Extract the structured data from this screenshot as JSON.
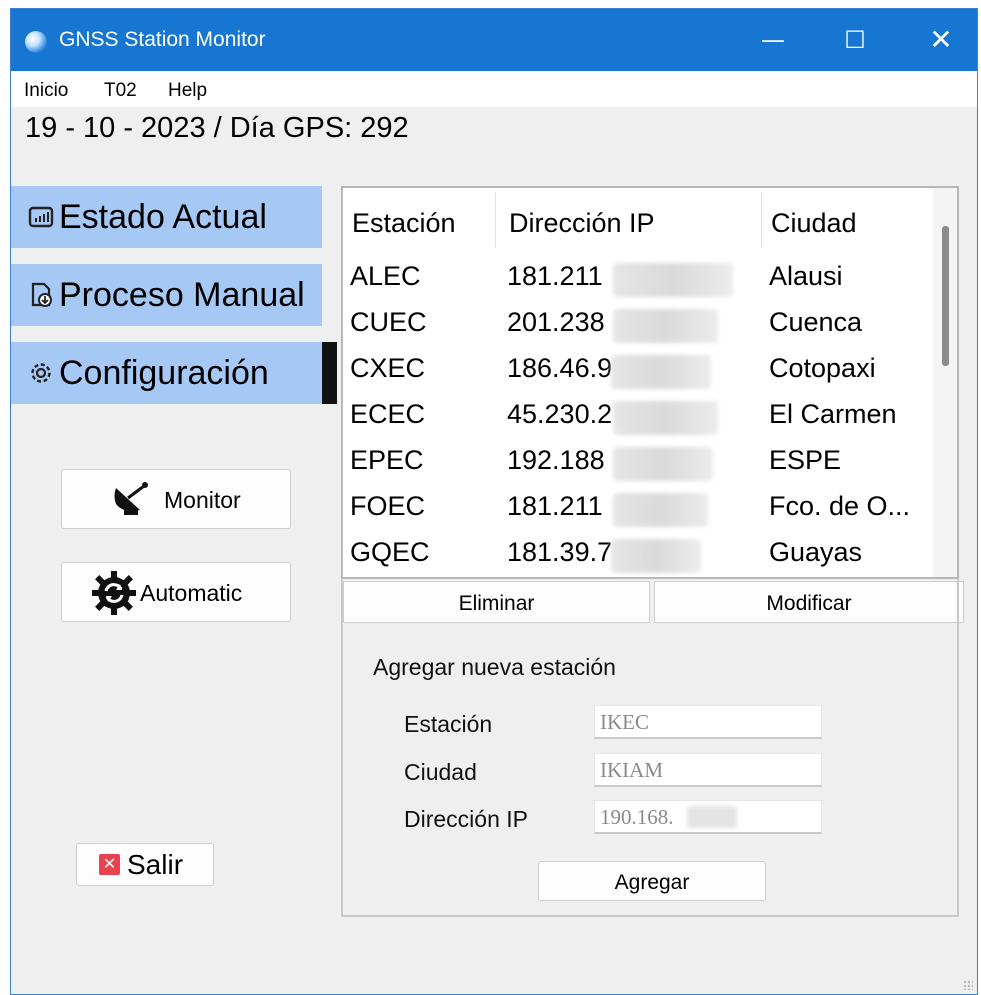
{
  "window": {
    "title": "GNSS Station Monitor",
    "controls": {
      "minimize": "—",
      "maximize": "☐",
      "close": "✕"
    }
  },
  "menu": [
    "Inicio",
    "T02",
    "Help"
  ],
  "date_line": "19 - 10 - 2023 / Día GPS: 292",
  "nav": [
    {
      "label": "Estado Actual",
      "icon": "monitor-icon"
    },
    {
      "label": "Proceso Manual",
      "icon": "document-download-icon"
    },
    {
      "label": "Configuración",
      "icon": "gear-icon",
      "active": true
    }
  ],
  "buttons": {
    "monitor": "Monitor",
    "automatic": "Automatic",
    "salir": "Salir",
    "eliminar": "Eliminar",
    "modificar": "Modificar",
    "agregar": "Agregar"
  },
  "table": {
    "headers": [
      "Estación",
      "Dirección IP",
      "Ciudad"
    ],
    "rows": [
      {
        "station": "ALEC",
        "ip": "181.211",
        "city": "Alausi"
      },
      {
        "station": "CUEC",
        "ip": "201.238",
        "city": "Cuenca"
      },
      {
        "station": "CXEC",
        "ip": "186.46.9",
        "city": "Cotopaxi"
      },
      {
        "station": "ECEC",
        "ip": "45.230.2",
        "city": "El Carmen"
      },
      {
        "station": "EPEC",
        "ip": "192.188",
        "city": "ESPE"
      },
      {
        "station": "FOEC",
        "ip": "181.211",
        "city": "Fco. de O..."
      },
      {
        "station": "GQEC",
        "ip": "181.39.7",
        "city": "Guayas"
      }
    ]
  },
  "form": {
    "title": "Agregar nueva estación",
    "station_label": "Estación",
    "station_value": "IKEC",
    "city_label": "Ciudad",
    "city_value": "IKIAM",
    "ip_label": "Dirección IP",
    "ip_value": "190.168."
  }
}
